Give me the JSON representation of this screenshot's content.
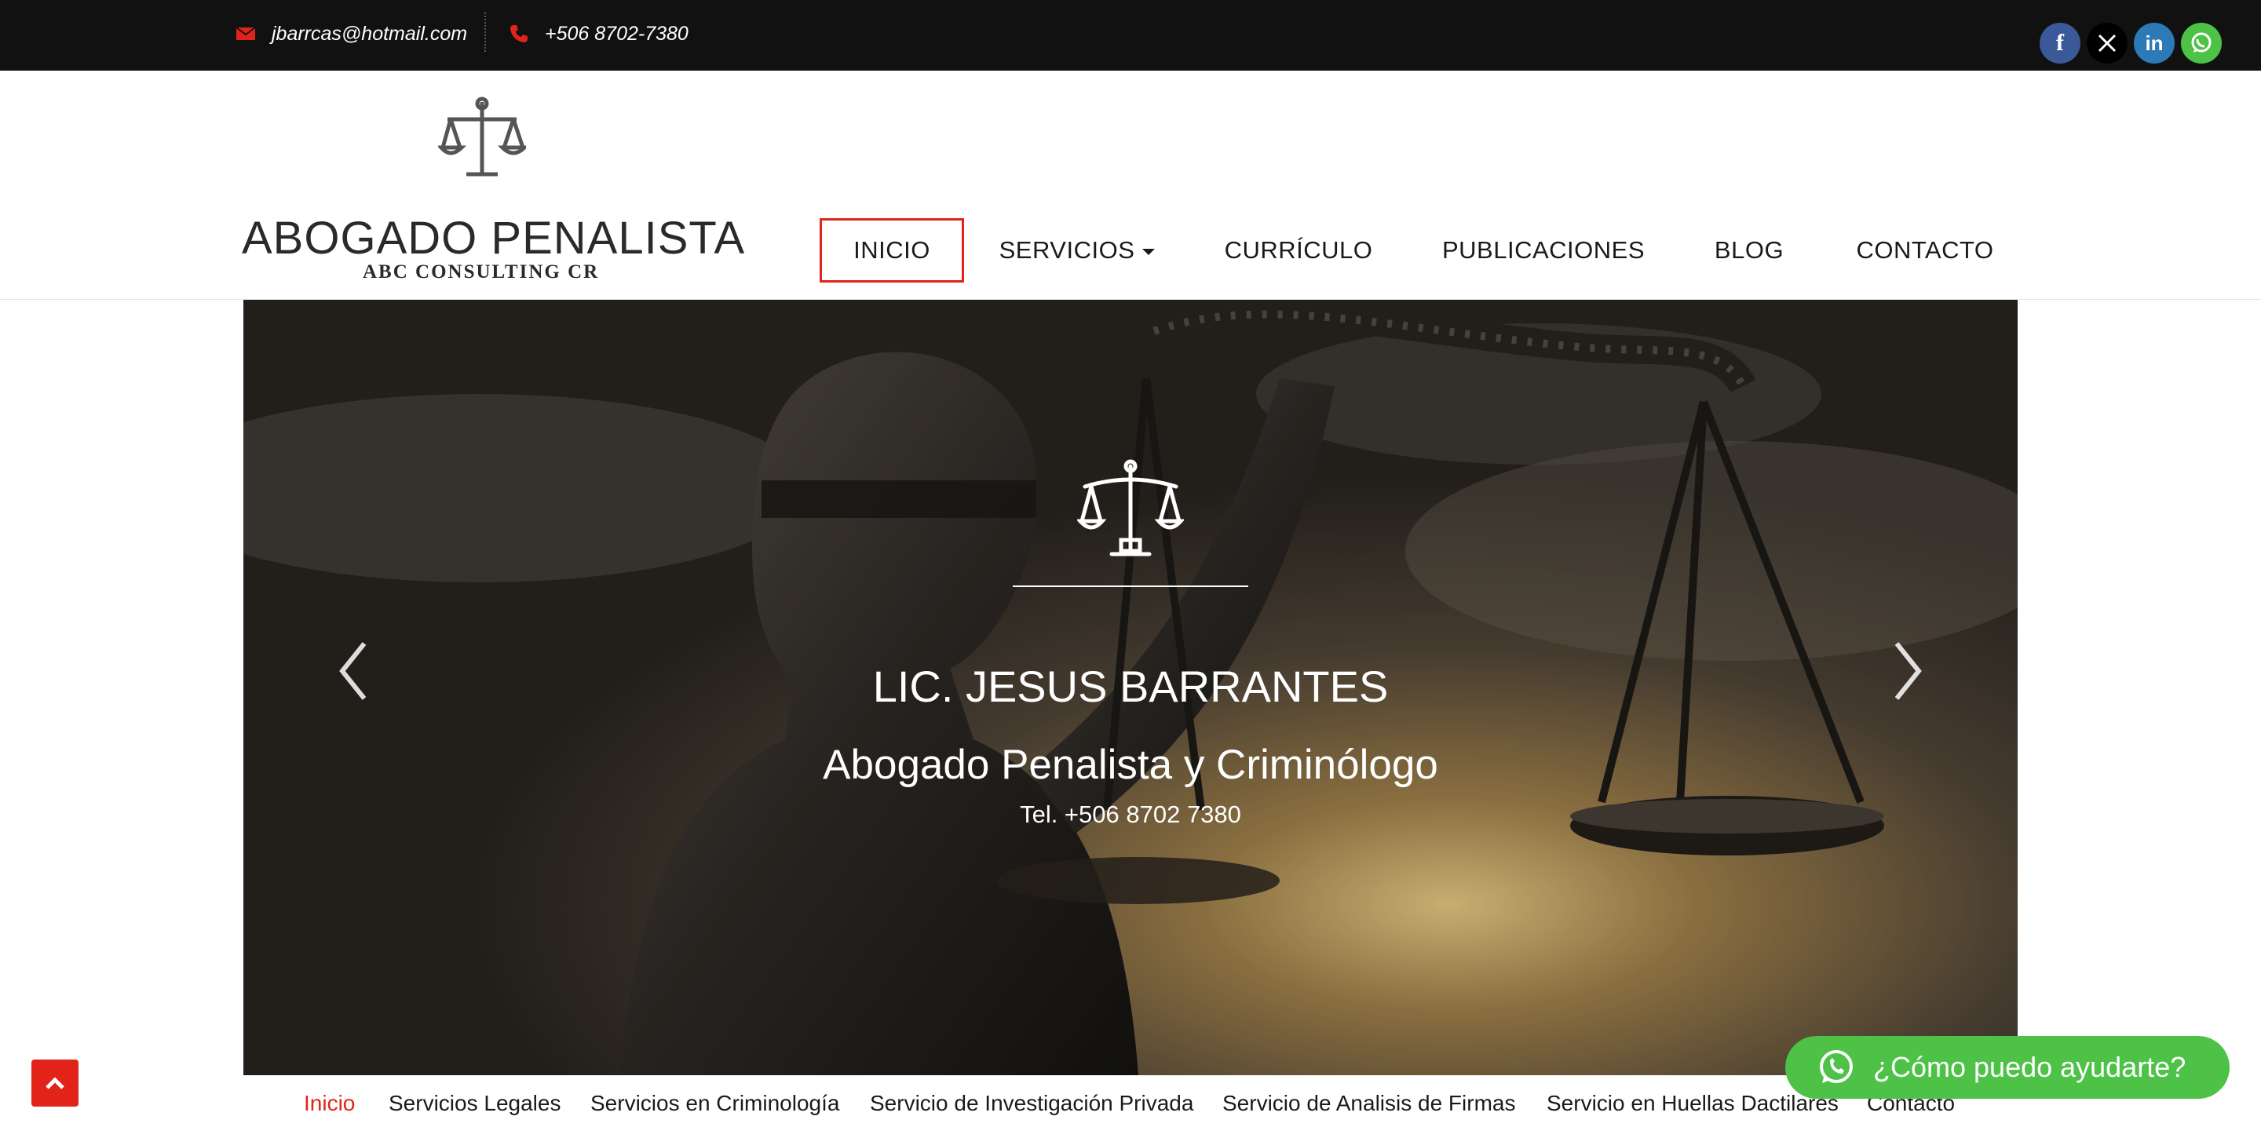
{
  "topbar": {
    "email": "jbarrcas@hotmail.com",
    "phone": "+506 8702-7380",
    "social": [
      {
        "icon": "facebook-icon",
        "glyph": "f",
        "color": "#3b5998"
      },
      {
        "icon": "x-icon",
        "glyph": "𝕏",
        "color": "#000000"
      },
      {
        "icon": "linkedin-icon",
        "glyph": "in",
        "color": "#2d7bb6"
      },
      {
        "icon": "whatsapp-icon",
        "glyph": "",
        "color": "#4dc247"
      }
    ]
  },
  "header": {
    "logo_title": "ABOGADO PENALISTA",
    "logo_subtitle": "ABC CONSULTING CR",
    "nav": [
      {
        "label": "INICIO",
        "active": true
      },
      {
        "label": "SERVICIOS",
        "dropdown": true
      },
      {
        "label": "CURRÍCULO"
      },
      {
        "label": "PUBLICACIONES"
      },
      {
        "label": "BLOG"
      },
      {
        "label": "CONTACTO"
      }
    ]
  },
  "slider": {
    "name": "LIC. JESUS BARRANTES",
    "title": "Abogado Penalista y Criminólogo",
    "phone": "Tel. +506 8702 7380",
    "prev_icon": "chevron-left-icon",
    "next_icon": "chevron-right-icon"
  },
  "quicklinks": [
    {
      "label": "Inicio",
      "active": true
    },
    {
      "label": "Servicios Legales"
    },
    {
      "label": "Servicios en Criminología"
    },
    {
      "label": "Servicio de Investigación Privada"
    },
    {
      "label": "Servicio de Analisis de Firmas"
    },
    {
      "label": "Servicio en Huellas Dactilares"
    },
    {
      "label": "Contacto"
    }
  ],
  "whatsapp_button": {
    "label": "¿Cómo puedo ayudarte?"
  },
  "colors": {
    "accent": "#e2231a",
    "whatsapp": "#4dc247",
    "topbar": "#111111"
  }
}
